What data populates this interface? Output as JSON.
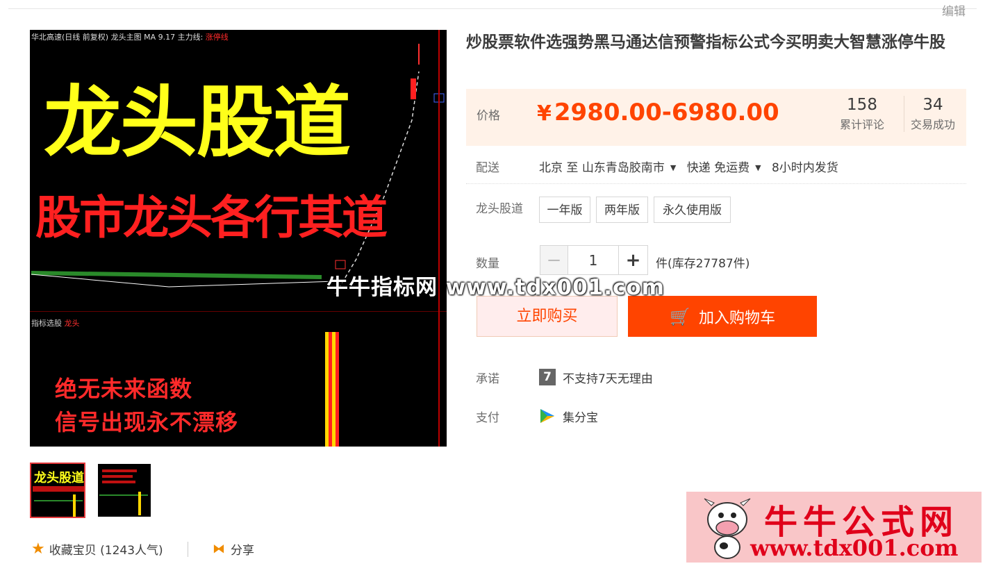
{
  "header": {
    "edit_label": "编辑"
  },
  "gallery": {
    "main_image": {
      "top_bar": "华北高速(日线 前复权) 龙头主图",
      "top_bar_extra": "MA 9.17  主力线:",
      "top_bar_red": "涨停线",
      "headline": "龙头股道",
      "subheadline": "股市龙头各行其道",
      "sub_label": "指标选股",
      "sub_label_red": "龙头",
      "line1": "绝无未来函数",
      "line2": "信号出现永不漂移"
    },
    "watermark": "牛牛指标网 www.tdx001.com",
    "thumbs": [
      {
        "text": "龙头股道"
      },
      {
        "text": ""
      }
    ]
  },
  "actions": {
    "favorite_label": "收藏宝贝 (1243人气)",
    "share_label": "分享"
  },
  "product": {
    "title": "炒股票软件选强势黑马通达信预警指标公式今买明卖大智慧涨停牛股",
    "price_label": "价格",
    "currency": "¥",
    "price": "2980.00-6980.00",
    "reviews_count": "158",
    "reviews_label": "累计评论",
    "sales_count": "34",
    "sales_label": "交易成功",
    "shipping_label": "配送",
    "ship_from": "北京 至",
    "ship_to": "山东青岛胶南市",
    "ship_method": "快递 免运费",
    "ship_time": "8小时内发货",
    "variant_label": "龙头股道",
    "variants": [
      "一年版",
      "两年版",
      "永久使用版"
    ],
    "qty_label": "数量",
    "qty_value": "1",
    "stock_text": "件(库存27787件)",
    "buy_now": "立即购买",
    "add_to_cart": "加入购物车",
    "promise_label": "承诺",
    "promise_icon_text": "7",
    "promise_text": "不支持7天无理由",
    "pay_label": "支付",
    "pay_text": "集分宝"
  },
  "logo": {
    "name": "牛牛公式网",
    "url": "www.tdx001.com"
  },
  "colors": {
    "accent": "#ff4400",
    "price": "#ff4400",
    "price_bg": "#fff2e8"
  }
}
